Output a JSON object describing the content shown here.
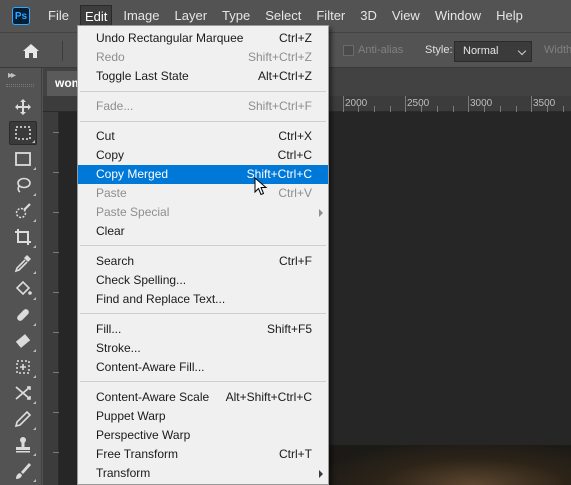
{
  "app": {
    "logo_text": "Ps"
  },
  "menubar": {
    "items": [
      "File",
      "Edit",
      "Image",
      "Layer",
      "Type",
      "Select",
      "Filter",
      "3D",
      "View",
      "Window",
      "Help"
    ],
    "active_index": 1
  },
  "options": {
    "antialias_label": "Anti-alias",
    "style_label": "Style:",
    "style_value": "Normal",
    "width_label": "Width"
  },
  "document": {
    "tab_title": "wom",
    "ruler_marks": [
      "2000",
      "2500",
      "3000",
      "3500"
    ]
  },
  "edit_menu": {
    "items": [
      {
        "label": "Undo Rectangular Marquee",
        "shortcut": "Ctrl+Z",
        "enabled": true
      },
      {
        "label": "Redo",
        "shortcut": "Shift+Ctrl+Z",
        "enabled": false
      },
      {
        "label": "Toggle Last State",
        "shortcut": "Alt+Ctrl+Z",
        "enabled": true
      },
      {
        "label": "Fade...",
        "shortcut": "Shift+Ctrl+F",
        "enabled": false
      },
      {
        "label": "Cut",
        "shortcut": "Ctrl+X",
        "enabled": true
      },
      {
        "label": "Copy",
        "shortcut": "Ctrl+C",
        "enabled": true
      },
      {
        "label": "Copy Merged",
        "shortcut": "Shift+Ctrl+C",
        "enabled": true,
        "highlighted": true
      },
      {
        "label": "Paste",
        "shortcut": "Ctrl+V",
        "enabled": false
      },
      {
        "label": "Paste Special",
        "shortcut": "",
        "enabled": false,
        "submenu": true
      },
      {
        "label": "Clear",
        "shortcut": "",
        "enabled": true
      },
      {
        "label": "Search",
        "shortcut": "Ctrl+F",
        "enabled": true
      },
      {
        "label": "Check Spelling...",
        "shortcut": "",
        "enabled": true
      },
      {
        "label": "Find and Replace Text...",
        "shortcut": "",
        "enabled": true
      },
      {
        "label": "Fill...",
        "shortcut": "Shift+F5",
        "enabled": true
      },
      {
        "label": "Stroke...",
        "shortcut": "",
        "enabled": true
      },
      {
        "label": "Content-Aware Fill...",
        "shortcut": "",
        "enabled": true
      },
      {
        "label": "Content-Aware Scale",
        "shortcut": "Alt+Shift+Ctrl+C",
        "enabled": true
      },
      {
        "label": "Puppet Warp",
        "shortcut": "",
        "enabled": true
      },
      {
        "label": "Perspective Warp",
        "shortcut": "",
        "enabled": true
      },
      {
        "label": "Free Transform",
        "shortcut": "Ctrl+T",
        "enabled": true
      },
      {
        "label": "Transform",
        "shortcut": "",
        "enabled": true,
        "submenu": true
      }
    ]
  },
  "tools": [
    "move-tool",
    "rectangular-marquee-tool",
    "frame-tool",
    "lasso-tool",
    "quick-selection-tool",
    "crop-tool",
    "eyedropper-tool",
    "paint-bucket-tool",
    "spot-healing-brush-tool",
    "eraser-tool",
    "content-aware-move-tool",
    "perspective-crop-tool",
    "pencil-tool",
    "clone-stamp-tool",
    "brush-tool"
  ],
  "colors": {
    "accent": "#0078d7",
    "panel": "#535353",
    "menu_bg": "#f0f0f0",
    "logo": "#31a8ff"
  }
}
